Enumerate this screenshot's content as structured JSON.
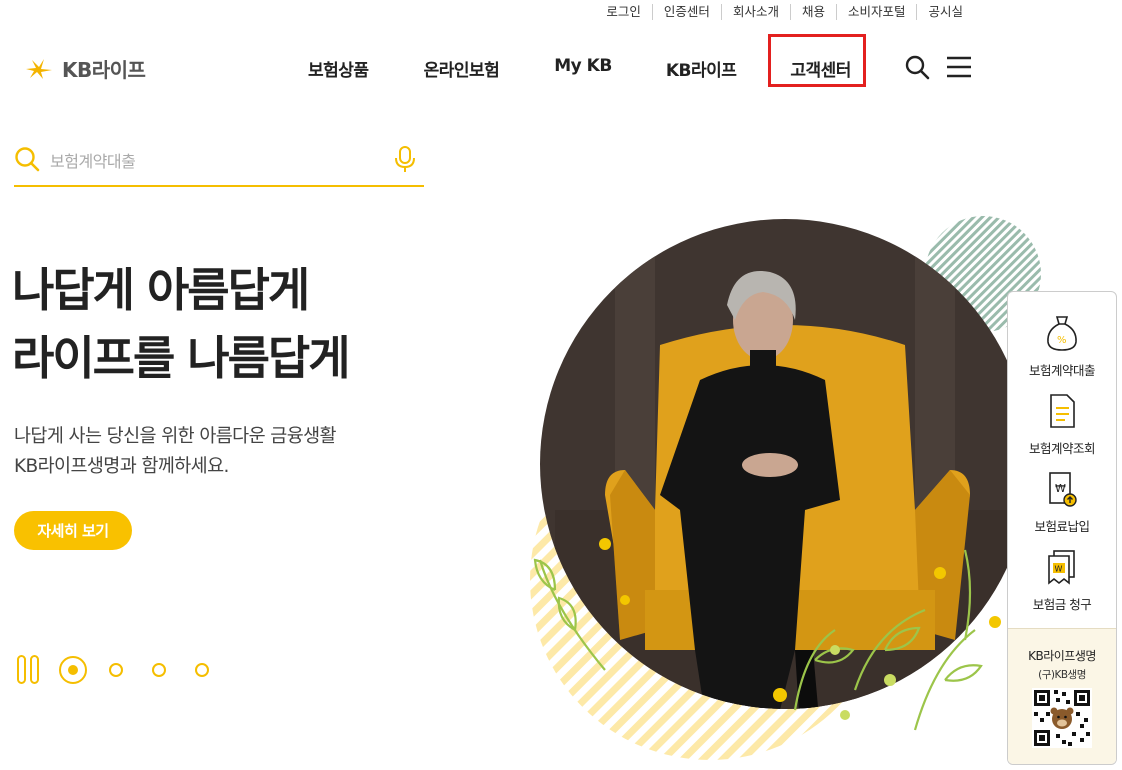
{
  "util_links": [
    "로그인",
    "인증센터",
    "회사소개",
    "채용",
    "소비자포털",
    "공시실"
  ],
  "logo": {
    "text": "KB라이프"
  },
  "gnb": [
    "보험상품",
    "온라인보험",
    "My KB",
    "KB라이프",
    "고객센터"
  ],
  "search": {
    "placeholder": "보험계약대출"
  },
  "hero": {
    "title_line1": "나답게 아름답게",
    "title_line2": "라이프를 나름답게",
    "sub_line1": "나답게 사는 당신을 위한 아름다운 금융생활",
    "sub_line2": "KB라이프생명과 함께하세요.",
    "button": "자세히 보기"
  },
  "quick_menu": {
    "items": [
      "보험계약대출",
      "보험계약조회",
      "보험료납입",
      "보험금 청구"
    ],
    "brand": "KB라이프생명",
    "brand_sub": "(구)KB생명"
  },
  "colors": {
    "accent": "#f9c100",
    "highlight": "#e3201f",
    "chair": "#e0a11c",
    "bg_dark": "#3f3530"
  }
}
